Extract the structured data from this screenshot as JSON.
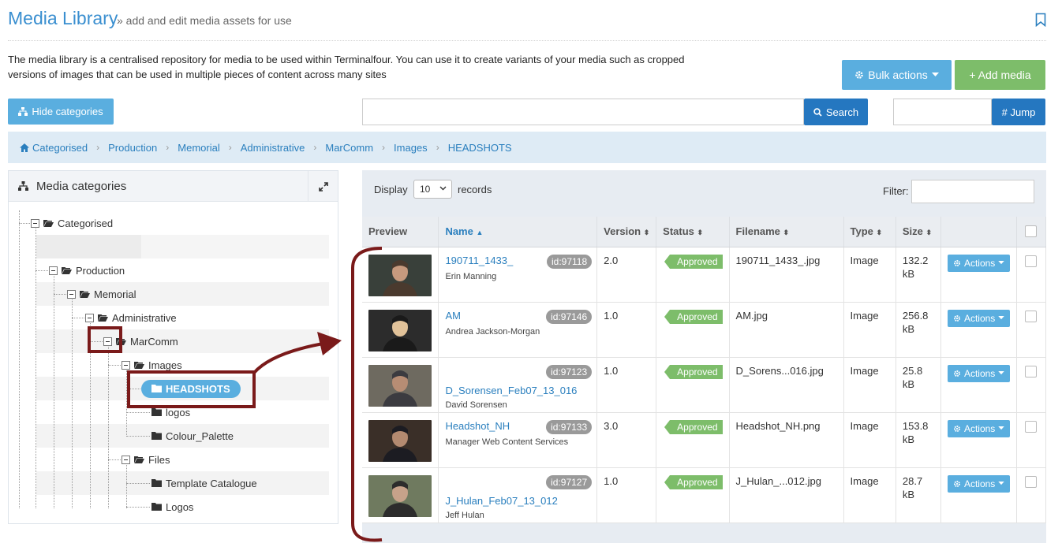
{
  "header": {
    "title": "Media Library",
    "subtitle": "» add and edit media assets for use"
  },
  "intro": "The media library is a centralised repository for media to be used within Terminalfour. You can use it to create variants of your media such as cropped versions of images that can be used in multiple pieces of content across many sites",
  "toolbar": {
    "bulk_actions": "Bulk actions",
    "add_media": "+ Add media",
    "hide_categories": "Hide categories",
    "search_label": "Search",
    "search_value": "",
    "jump_label": "# Jump",
    "jump_value": ""
  },
  "breadcrumb": [
    "Categorised",
    "Production",
    "Memorial",
    "Administrative",
    "MarComm",
    "Images",
    "HEADSHOTS"
  ],
  "categories": {
    "title": "Media categories",
    "nodes": [
      {
        "label": "Categorised"
      },
      {
        "label": "Production"
      },
      {
        "label": "Memorial"
      },
      {
        "label": "Administrative"
      },
      {
        "label": "MarComm"
      },
      {
        "label": "Images"
      },
      {
        "label": "HEADSHOTS"
      },
      {
        "label": "logos"
      },
      {
        "label": "Colour_Palette"
      },
      {
        "label": "Files"
      },
      {
        "label": "Template Catalogue"
      },
      {
        "label": "Logos"
      }
    ]
  },
  "table": {
    "display_label": "Display",
    "display_value": "10",
    "records_label": "records",
    "filter_label": "Filter:",
    "filter_value": "",
    "columns": [
      "Preview",
      "Name",
      "Version",
      "Status",
      "Filename",
      "Type",
      "Size"
    ],
    "actions_label": "Actions",
    "rows": [
      {
        "name": "190711_1433_",
        "sub": "Erin Manning",
        "id": "id:97118",
        "version": "2.0",
        "status": "Approved",
        "filename": "190711_1433_.jpg",
        "type": "Image",
        "size": "132.2 kB",
        "name_top": true
      },
      {
        "name": "AM",
        "sub": "Andrea Jackson-Morgan",
        "id": "id:97146",
        "version": "1.0",
        "status": "Approved",
        "filename": "AM.jpg",
        "type": "Image",
        "size": "256.8 kB",
        "name_top": true
      },
      {
        "name": "D_Sorensen_Feb07_13_016",
        "sub": "David Sorensen",
        "id": "id:97123",
        "version": "1.0",
        "status": "Approved",
        "filename": "D_Sorens...016.jpg",
        "type": "Image",
        "size": "25.8 kB",
        "name_top": false
      },
      {
        "name": "Headshot_NH",
        "sub": "Manager Web Content Services",
        "id": "id:97133",
        "version": "3.0",
        "status": "Approved",
        "filename": "Headshot_NH.png",
        "type": "Image",
        "size": "153.8 kB",
        "name_top": true
      },
      {
        "name": "J_Hulan_Feb07_13_012",
        "sub": "Jeff Hulan",
        "id": "id:97127",
        "version": "1.0",
        "status": "Approved",
        "filename": "J_Hulan_...012.jpg",
        "type": "Image",
        "size": "28.7 kB",
        "name_top": false
      }
    ]
  },
  "colors": {
    "accent": "#5aaedf",
    "link": "#2a7fbe",
    "approved": "#7dbd6a",
    "annotation": "#7a1a1a"
  }
}
